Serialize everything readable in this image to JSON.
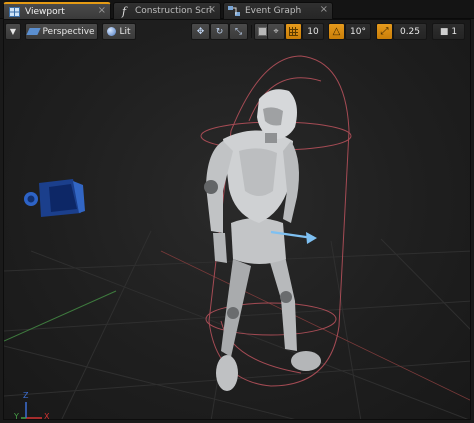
{
  "tabs": [
    {
      "label": "Viewport",
      "icon": "viewport-grid-icon"
    },
    {
      "label": "Construction Scri",
      "icon": "function-icon"
    },
    {
      "label": "Event Graph",
      "icon": "event-graph-icon"
    }
  ],
  "toolbar": {
    "view_mode": "Perspective",
    "lighting_mode": "Lit",
    "grid_snap_value": "10",
    "rotation_snap_value": "10°",
    "scale_snap_value": "0.25",
    "camera_speed": "1"
  },
  "gizmo_axes": {
    "y": "Y",
    "z": "Z",
    "x": "X"
  },
  "colors": {
    "accent_orange": "#e59b14",
    "viewport_bg": "#222222",
    "capsule": "#b4505a",
    "arrow": "#7ec0f2",
    "axis_x": "#d23232",
    "axis_y": "#46a046",
    "axis_z": "#3c6ed2"
  }
}
